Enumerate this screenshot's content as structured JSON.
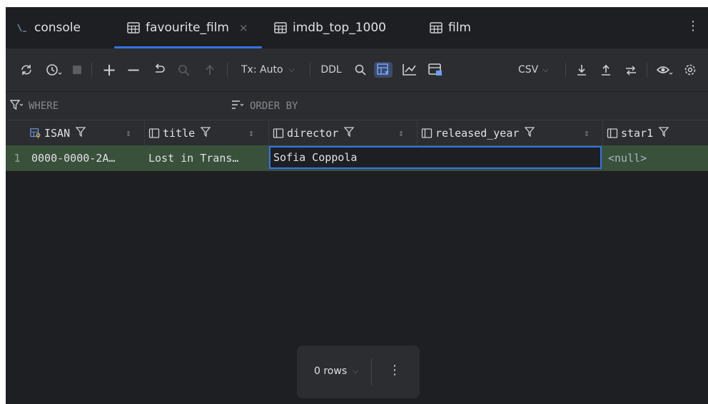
{
  "tabs": [
    {
      "label": "console",
      "icon": "console-icon"
    },
    {
      "label": "favourite_film",
      "icon": "table-icon",
      "active": true,
      "close": "×"
    },
    {
      "label": "imdb_top_1000",
      "icon": "table-icon"
    },
    {
      "label": "film",
      "icon": "table-icon"
    }
  ],
  "toolbar": {
    "tx_mode": "Tx: Auto",
    "ddl": "DDL",
    "export_format": "CSV"
  },
  "filters": {
    "where": "WHERE",
    "order_by": "ORDER BY"
  },
  "columns": [
    "ISAN",
    "title",
    "director",
    "released_year",
    "star1"
  ],
  "rows": [
    {
      "num": "1",
      "ISAN": "0000-0000-2A…",
      "title": "Lost in Trans…",
      "director": "Sofia Coppola",
      "star1": "<null>"
    }
  ],
  "status": {
    "rows_label": "0 rows"
  },
  "colors": {
    "accent": "#3574f0",
    "modified_row": "#39503a",
    "background": "#1e1f22",
    "toolbar": "#2b2d30"
  }
}
